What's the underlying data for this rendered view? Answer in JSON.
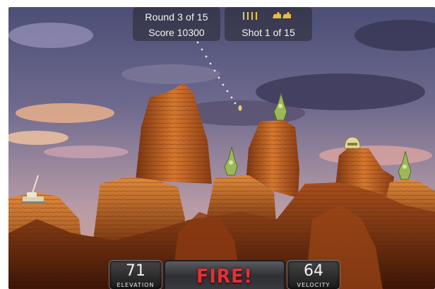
{
  "hud": {
    "round_text": "Round 3 of 15",
    "score_text": "Score 10300",
    "shot_text": "Shot 1 of 15",
    "ammo_icon": "bullet-icon",
    "bonus_icon": "tank-icon"
  },
  "controls": {
    "elevation_value": "71",
    "elevation_label": "ELEVATION",
    "velocity_value": "64",
    "velocity_label": "VELOCITY",
    "fire_label": "FIRE!"
  },
  "colors": {
    "fire_text": "#e0313a",
    "hud_bg": "#28283088",
    "rock": "#c0662a",
    "tank": "#8fb04a"
  }
}
